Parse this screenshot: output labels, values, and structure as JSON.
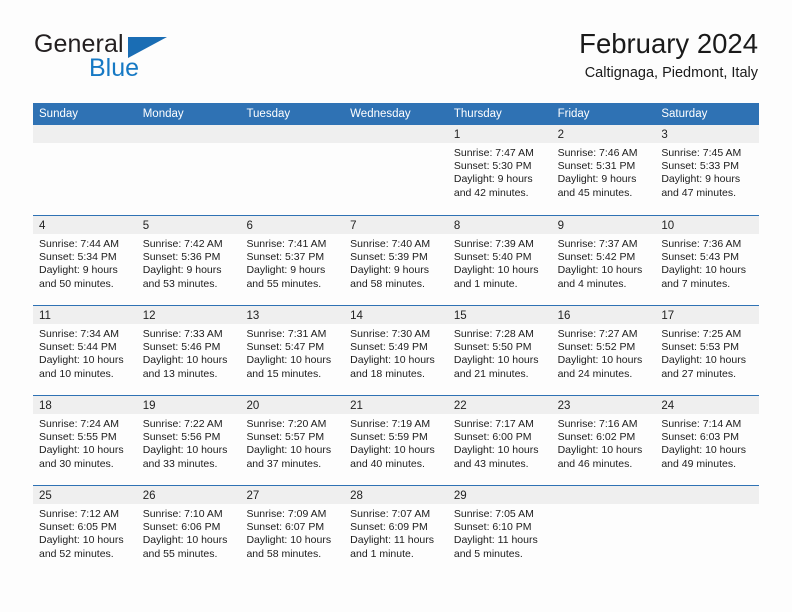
{
  "brand": {
    "name_part1": "General",
    "name_part2": "Blue"
  },
  "header": {
    "title": "February 2024",
    "location": "Caltignaga, Piedmont, Italy"
  },
  "colors": {
    "header_blue": "#2f72b4",
    "brand_blue": "#1679c4",
    "daynum_band": "#efefef",
    "text": "#1c1c1c",
    "page_background": "#fdfdfd"
  },
  "weekday_headers": [
    "Sunday",
    "Monday",
    "Tuesday",
    "Wednesday",
    "Thursday",
    "Friday",
    "Saturday"
  ],
  "weeks": [
    [
      {
        "empty": true
      },
      {
        "empty": true
      },
      {
        "empty": true
      },
      {
        "empty": true
      },
      {
        "day": "1",
        "sunrise": "Sunrise: 7:47 AM",
        "sunset": "Sunset: 5:30 PM",
        "daylight1": "Daylight: 9 hours",
        "daylight2": "and 42 minutes."
      },
      {
        "day": "2",
        "sunrise": "Sunrise: 7:46 AM",
        "sunset": "Sunset: 5:31 PM",
        "daylight1": "Daylight: 9 hours",
        "daylight2": "and 45 minutes."
      },
      {
        "day": "3",
        "sunrise": "Sunrise: 7:45 AM",
        "sunset": "Sunset: 5:33 PM",
        "daylight1": "Daylight: 9 hours",
        "daylight2": "and 47 minutes."
      }
    ],
    [
      {
        "day": "4",
        "sunrise": "Sunrise: 7:44 AM",
        "sunset": "Sunset: 5:34 PM",
        "daylight1": "Daylight: 9 hours",
        "daylight2": "and 50 minutes."
      },
      {
        "day": "5",
        "sunrise": "Sunrise: 7:42 AM",
        "sunset": "Sunset: 5:36 PM",
        "daylight1": "Daylight: 9 hours",
        "daylight2": "and 53 minutes."
      },
      {
        "day": "6",
        "sunrise": "Sunrise: 7:41 AM",
        "sunset": "Sunset: 5:37 PM",
        "daylight1": "Daylight: 9 hours",
        "daylight2": "and 55 minutes."
      },
      {
        "day": "7",
        "sunrise": "Sunrise: 7:40 AM",
        "sunset": "Sunset: 5:39 PM",
        "daylight1": "Daylight: 9 hours",
        "daylight2": "and 58 minutes."
      },
      {
        "day": "8",
        "sunrise": "Sunrise: 7:39 AM",
        "sunset": "Sunset: 5:40 PM",
        "daylight1": "Daylight: 10 hours",
        "daylight2": "and 1 minute."
      },
      {
        "day": "9",
        "sunrise": "Sunrise: 7:37 AM",
        "sunset": "Sunset: 5:42 PM",
        "daylight1": "Daylight: 10 hours",
        "daylight2": "and 4 minutes."
      },
      {
        "day": "10",
        "sunrise": "Sunrise: 7:36 AM",
        "sunset": "Sunset: 5:43 PM",
        "daylight1": "Daylight: 10 hours",
        "daylight2": "and 7 minutes."
      }
    ],
    [
      {
        "day": "11",
        "sunrise": "Sunrise: 7:34 AM",
        "sunset": "Sunset: 5:44 PM",
        "daylight1": "Daylight: 10 hours",
        "daylight2": "and 10 minutes."
      },
      {
        "day": "12",
        "sunrise": "Sunrise: 7:33 AM",
        "sunset": "Sunset: 5:46 PM",
        "daylight1": "Daylight: 10 hours",
        "daylight2": "and 13 minutes."
      },
      {
        "day": "13",
        "sunrise": "Sunrise: 7:31 AM",
        "sunset": "Sunset: 5:47 PM",
        "daylight1": "Daylight: 10 hours",
        "daylight2": "and 15 minutes."
      },
      {
        "day": "14",
        "sunrise": "Sunrise: 7:30 AM",
        "sunset": "Sunset: 5:49 PM",
        "daylight1": "Daylight: 10 hours",
        "daylight2": "and 18 minutes."
      },
      {
        "day": "15",
        "sunrise": "Sunrise: 7:28 AM",
        "sunset": "Sunset: 5:50 PM",
        "daylight1": "Daylight: 10 hours",
        "daylight2": "and 21 minutes."
      },
      {
        "day": "16",
        "sunrise": "Sunrise: 7:27 AM",
        "sunset": "Sunset: 5:52 PM",
        "daylight1": "Daylight: 10 hours",
        "daylight2": "and 24 minutes."
      },
      {
        "day": "17",
        "sunrise": "Sunrise: 7:25 AM",
        "sunset": "Sunset: 5:53 PM",
        "daylight1": "Daylight: 10 hours",
        "daylight2": "and 27 minutes."
      }
    ],
    [
      {
        "day": "18",
        "sunrise": "Sunrise: 7:24 AM",
        "sunset": "Sunset: 5:55 PM",
        "daylight1": "Daylight: 10 hours",
        "daylight2": "and 30 minutes."
      },
      {
        "day": "19",
        "sunrise": "Sunrise: 7:22 AM",
        "sunset": "Sunset: 5:56 PM",
        "daylight1": "Daylight: 10 hours",
        "daylight2": "and 33 minutes."
      },
      {
        "day": "20",
        "sunrise": "Sunrise: 7:20 AM",
        "sunset": "Sunset: 5:57 PM",
        "daylight1": "Daylight: 10 hours",
        "daylight2": "and 37 minutes."
      },
      {
        "day": "21",
        "sunrise": "Sunrise: 7:19 AM",
        "sunset": "Sunset: 5:59 PM",
        "daylight1": "Daylight: 10 hours",
        "daylight2": "and 40 minutes."
      },
      {
        "day": "22",
        "sunrise": "Sunrise: 7:17 AM",
        "sunset": "Sunset: 6:00 PM",
        "daylight1": "Daylight: 10 hours",
        "daylight2": "and 43 minutes."
      },
      {
        "day": "23",
        "sunrise": "Sunrise: 7:16 AM",
        "sunset": "Sunset: 6:02 PM",
        "daylight1": "Daylight: 10 hours",
        "daylight2": "and 46 minutes."
      },
      {
        "day": "24",
        "sunrise": "Sunrise: 7:14 AM",
        "sunset": "Sunset: 6:03 PM",
        "daylight1": "Daylight: 10 hours",
        "daylight2": "and 49 minutes."
      }
    ],
    [
      {
        "day": "25",
        "sunrise": "Sunrise: 7:12 AM",
        "sunset": "Sunset: 6:05 PM",
        "daylight1": "Daylight: 10 hours",
        "daylight2": "and 52 minutes."
      },
      {
        "day": "26",
        "sunrise": "Sunrise: 7:10 AM",
        "sunset": "Sunset: 6:06 PM",
        "daylight1": "Daylight: 10 hours",
        "daylight2": "and 55 minutes."
      },
      {
        "day": "27",
        "sunrise": "Sunrise: 7:09 AM",
        "sunset": "Sunset: 6:07 PM",
        "daylight1": "Daylight: 10 hours",
        "daylight2": "and 58 minutes."
      },
      {
        "day": "28",
        "sunrise": "Sunrise: 7:07 AM",
        "sunset": "Sunset: 6:09 PM",
        "daylight1": "Daylight: 11 hours",
        "daylight2": "and 1 minute."
      },
      {
        "day": "29",
        "sunrise": "Sunrise: 7:05 AM",
        "sunset": "Sunset: 6:10 PM",
        "daylight1": "Daylight: 11 hours",
        "daylight2": "and 5 minutes."
      },
      {
        "empty": true
      },
      {
        "empty": true
      }
    ]
  ]
}
